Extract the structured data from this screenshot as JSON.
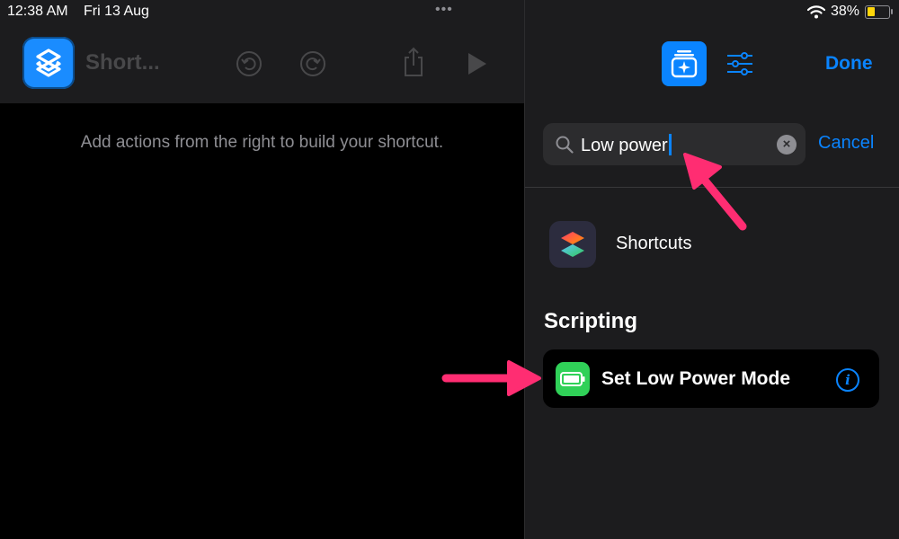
{
  "status_bar": {
    "time": "12:38 AM",
    "date": "Fri 13 Aug",
    "multitask": "•••",
    "battery_percent": "38%",
    "battery_level": 0.38,
    "battery_color": "#ffd60a"
  },
  "editor": {
    "title": "Short...",
    "hint": "Add actions from the right to build your shortcut.",
    "toolbar_icons": [
      "undo-icon",
      "redo-icon",
      "share-icon",
      "play-icon"
    ]
  },
  "panel": {
    "done_label": "Done",
    "search": {
      "value": "Low power",
      "cancel_label": "Cancel"
    },
    "app_result": {
      "label": "Shortcuts",
      "icon": "shortcuts-app-icon"
    },
    "section_header": "Scripting",
    "action": {
      "label": "Set Low Power Mode",
      "icon": "battery-icon",
      "icon_color": "#30d158"
    }
  },
  "colors": {
    "accent": "#0a84ff",
    "annotation": "#ff2d72",
    "panel_bg": "#1c1c1e"
  }
}
